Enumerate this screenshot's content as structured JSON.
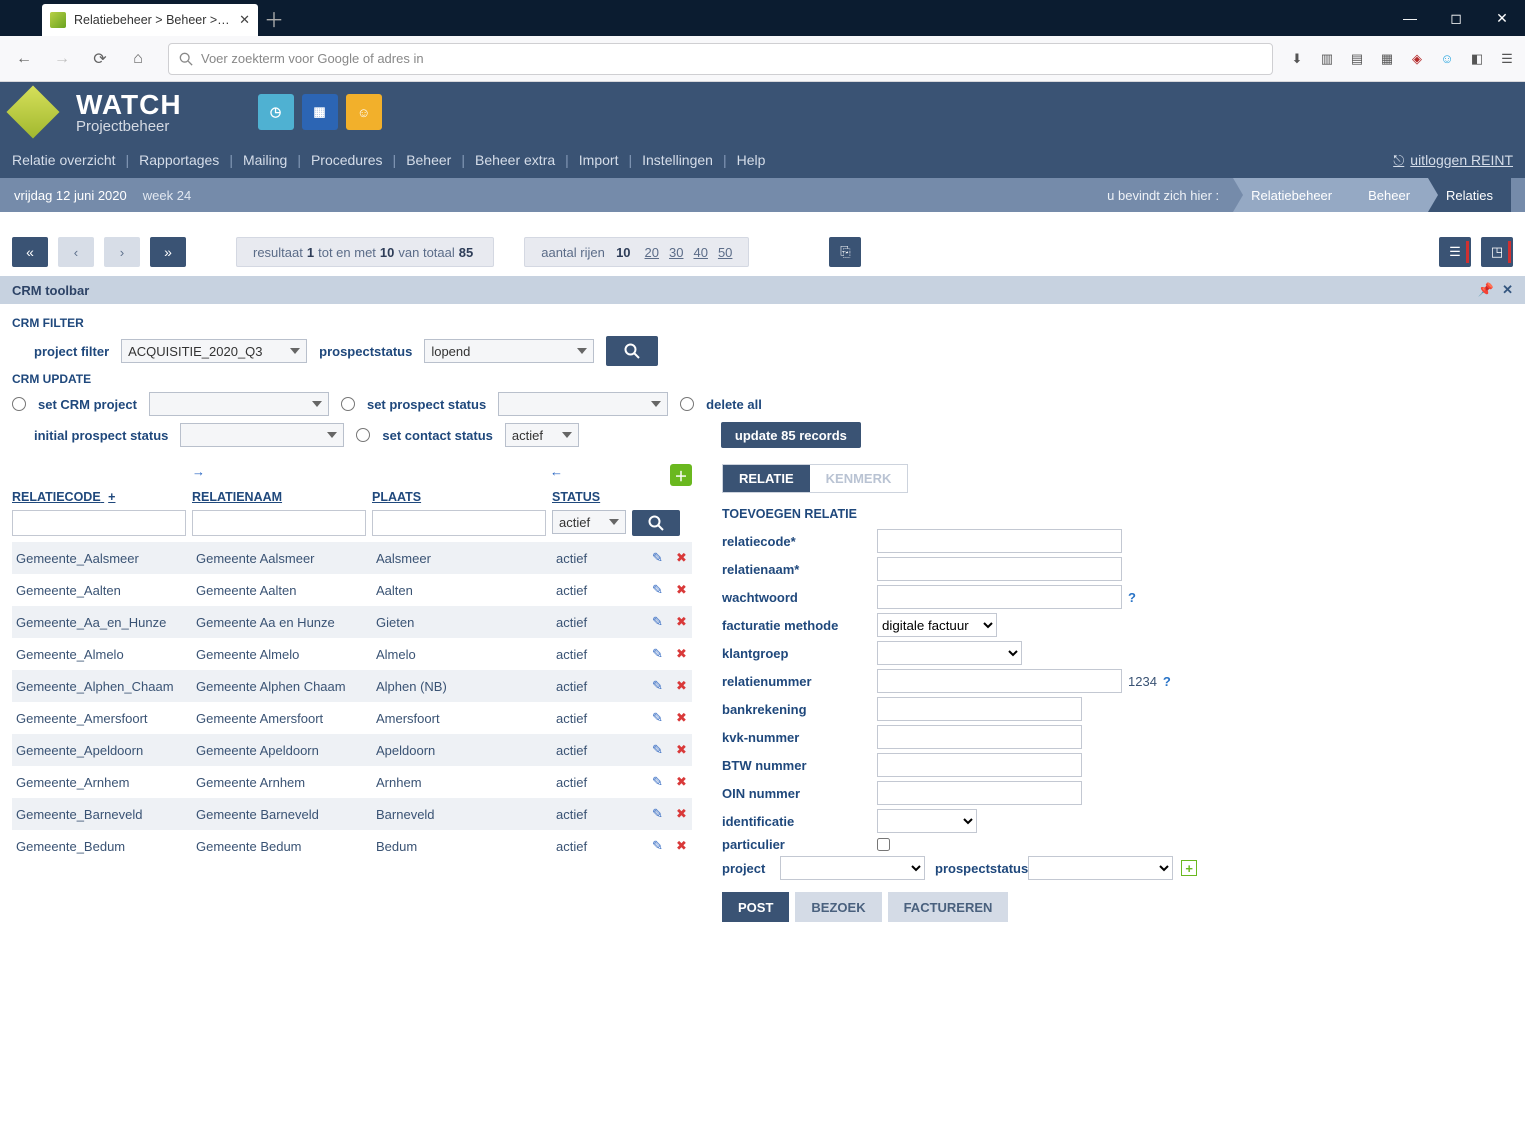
{
  "browser": {
    "tab_title": "Relatiebeheer > Beheer > Relat",
    "url_placeholder": "Voer zoekterm voor Google of adres in"
  },
  "logo": {
    "line1": "WATCH",
    "line2": "Projectbeheer"
  },
  "nav": {
    "items": [
      "Relatie overzicht",
      "Rapportages",
      "Mailing",
      "Procedures",
      "Beheer",
      "Beheer extra",
      "Import",
      "Instellingen",
      "Help"
    ],
    "logout": "uitloggen REINT"
  },
  "crumb": {
    "date": "vrijdag 12 juni 2020",
    "week": "week 24",
    "label": "u bevindt zich hier :",
    "trail": [
      "Relatiebeheer",
      "Beheer",
      "Relaties"
    ]
  },
  "pager": {
    "result_prefix": "resultaat",
    "result_from": "1",
    "result_mid": "tot en met",
    "result_to": "10",
    "result_of": "van totaal",
    "result_total": "85",
    "rows_label": "aantal rijen",
    "rows_current": "10",
    "rows_options": [
      "20",
      "30",
      "40",
      "50"
    ]
  },
  "toolbar": {
    "title": "CRM toolbar",
    "filter_title": "CRM FILTER",
    "update_title": "CRM UPDATE",
    "project_filter_label": "project filter",
    "project_filter_value": "ACQUISITIE_2020_Q3",
    "prospectstatus_label": "prospectstatus",
    "prospectstatus_value": "lopend",
    "set_crm_project": "set CRM project",
    "initial_prospect_status": "initial prospect status",
    "set_prospect_status": "set prospect status",
    "set_contact_status": "set contact status",
    "set_contact_status_value": "actief",
    "delete_all": "delete all",
    "update_button": "update 85 records"
  },
  "grid": {
    "headers": {
      "code": "RELATIECODE",
      "name": "RELATIENAAM",
      "place": "PLAATS",
      "status": "STATUS"
    },
    "status_filter_value": "actief",
    "rows": [
      {
        "code": "Gemeente_Aalsmeer",
        "name": "Gemeente Aalsmeer",
        "place": "Aalsmeer",
        "status": "actief"
      },
      {
        "code": "Gemeente_Aalten",
        "name": "Gemeente Aalten",
        "place": "Aalten",
        "status": "actief"
      },
      {
        "code": "Gemeente_Aa_en_Hunze",
        "name": "Gemeente Aa en Hunze",
        "place": "Gieten",
        "status": "actief"
      },
      {
        "code": "Gemeente_Almelo",
        "name": "Gemeente Almelo",
        "place": "Almelo",
        "status": "actief"
      },
      {
        "code": "Gemeente_Alphen_Chaam",
        "name": "Gemeente Alphen Chaam",
        "place": "Alphen (NB)",
        "status": "actief"
      },
      {
        "code": "Gemeente_Amersfoort",
        "name": "Gemeente Amersfoort",
        "place": "Amersfoort",
        "status": "actief"
      },
      {
        "code": "Gemeente_Apeldoorn",
        "name": "Gemeente Apeldoorn",
        "place": "Apeldoorn",
        "status": "actief"
      },
      {
        "code": "Gemeente_Arnhem",
        "name": "Gemeente Arnhem",
        "place": "Arnhem",
        "status": "actief"
      },
      {
        "code": "Gemeente_Barneveld",
        "name": "Gemeente Barneveld",
        "place": "Barneveld",
        "status": "actief"
      },
      {
        "code": "Gemeente_Bedum",
        "name": "Gemeente Bedum",
        "place": "Bedum",
        "status": "actief"
      }
    ]
  },
  "form": {
    "tabs": [
      "RELATIE",
      "KENMERK"
    ],
    "section_title": "TOEVOEGEN RELATIE",
    "fields": {
      "relatiecode": "relatiecode*",
      "relatienaam": "relatienaam*",
      "wachtwoord": "wachtwoord",
      "facturatie": "facturatie methode",
      "facturatie_value": "digitale factuur",
      "klantgroep": "klantgroep",
      "relatienummer": "relatienummer",
      "relatienummer_hint": "1234",
      "bankrekening": "bankrekening",
      "kvk": "kvk-nummer",
      "btw": "BTW nummer",
      "oin": "OIN nummer",
      "identificatie": "identificatie",
      "particulier": "particulier",
      "project": "project",
      "prospectstatus": "prospectstatus"
    },
    "buttons": [
      "POST",
      "BEZOEK",
      "FACTUREREN"
    ]
  }
}
